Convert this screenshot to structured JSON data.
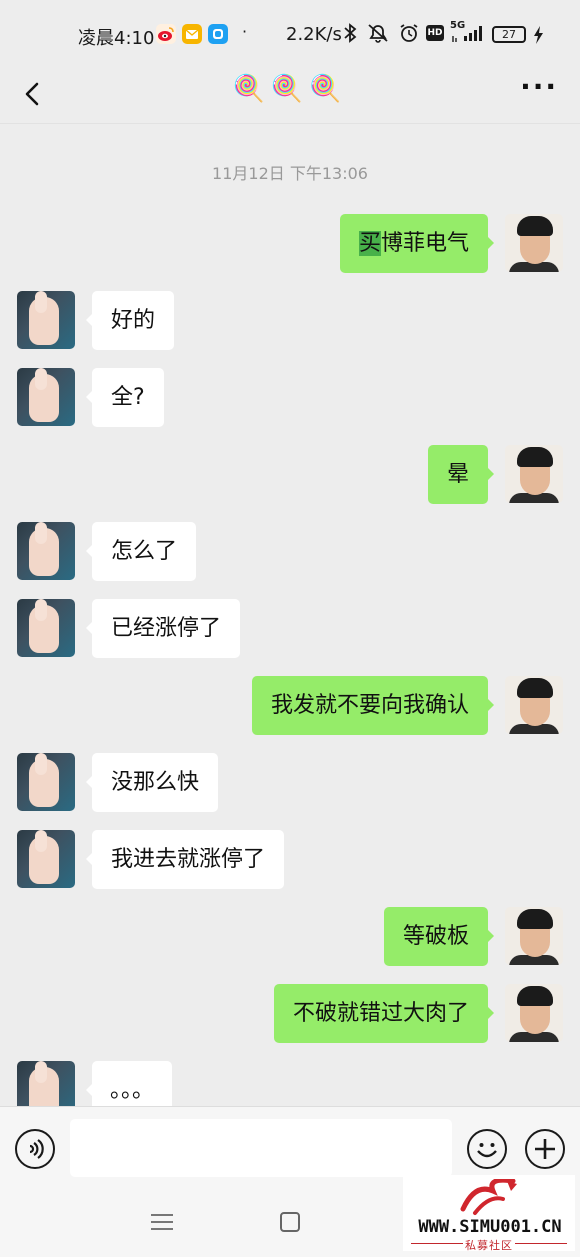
{
  "status_bar": {
    "time": "凌晨4:10",
    "dot": "·",
    "net_speed": "2.2K/s",
    "hd_label": "HD",
    "network_type": "5G",
    "battery": "27"
  },
  "header": {
    "title": "🍭🍭🍭"
  },
  "chat": {
    "timestamp": "11月12日 下午13:06",
    "messages": [
      {
        "side": "right",
        "text": "买博菲电气",
        "highlight": "买"
      },
      {
        "side": "left",
        "text": "好的"
      },
      {
        "side": "left",
        "text": "全?"
      },
      {
        "side": "right",
        "text": "晕"
      },
      {
        "side": "left",
        "text": "怎么了"
      },
      {
        "side": "left",
        "text": "已经涨停了"
      },
      {
        "side": "right",
        "text": "我发就不要向我确认"
      },
      {
        "side": "left",
        "text": "没那么快"
      },
      {
        "side": "left",
        "text": "我进去就涨停了"
      },
      {
        "side": "right",
        "text": "等破板"
      },
      {
        "side": "right",
        "text": "不破就错过大肉了"
      },
      {
        "side": "left",
        "text": "。。。"
      }
    ]
  },
  "input": {
    "value": "",
    "placeholder": ""
  },
  "watermark": {
    "site": "WWW.SIMU001.CN",
    "subtitle": "私募社区"
  },
  "colors": {
    "sent_bubble": "#95ec69",
    "received_bubble": "#ffffff",
    "background": "#ededed",
    "highlight": "#48b14a"
  }
}
